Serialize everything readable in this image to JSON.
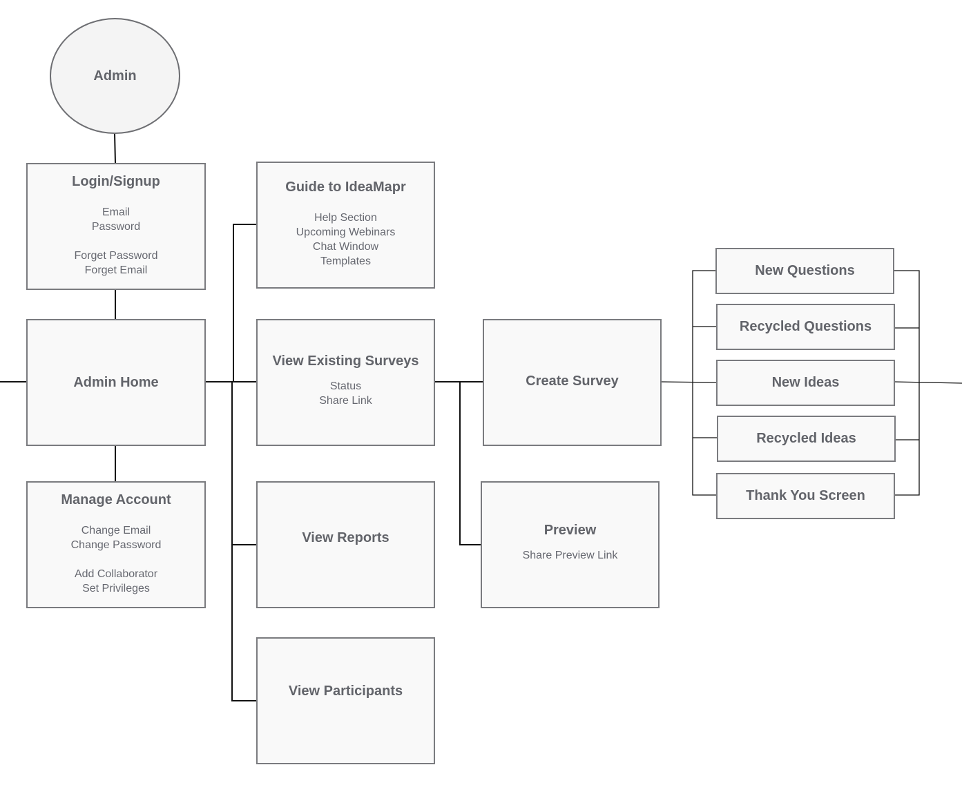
{
  "nodes": {
    "admin": {
      "title": "Admin"
    },
    "login": {
      "title": "Login/Signup",
      "details": [
        "Email",
        "Password",
        "",
        "Forget Password",
        "Forget Email"
      ]
    },
    "admin_home": {
      "title": "Admin Home"
    },
    "manage_account": {
      "title": "Manage Account",
      "details": [
        "Change Email",
        "Change Password",
        "",
        "Add Collaborator",
        "Set Privileges"
      ]
    },
    "guide": {
      "title": "Guide to IdeaMapr",
      "details": [
        "Help Section",
        "Upcoming Webinars",
        "Chat Window",
        "Templates"
      ]
    },
    "view_existing": {
      "title": "View Existing Surveys",
      "details": [
        "Status",
        "Share Link"
      ]
    },
    "view_reports": {
      "title": "View Reports"
    },
    "view_participants": {
      "title": "View Participants"
    },
    "create_survey": {
      "title": "Create Survey"
    },
    "preview": {
      "title": "Preview",
      "details": [
        "Share Preview Link"
      ]
    },
    "new_questions": {
      "title": "New Questions"
    },
    "recycled_questions": {
      "title": "Recycled Questions"
    },
    "new_ideas": {
      "title": "New Ideas"
    },
    "recycled_ideas": {
      "title": "Recycled Ideas"
    },
    "thank_you": {
      "title": "Thank You Screen"
    }
  },
  "colors": {
    "box_fill": "#f9f9f9",
    "box_border": "#7a7b7f",
    "text": "#62646a",
    "connector": "#000000"
  }
}
